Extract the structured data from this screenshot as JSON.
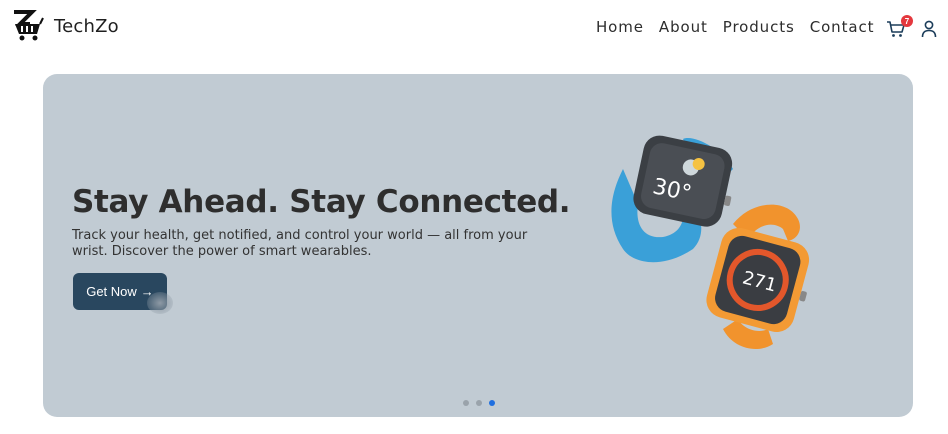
{
  "brand": {
    "name": "TechZo",
    "logo_icon": "shopping-cart-z-logo"
  },
  "nav": {
    "items": [
      {
        "label": "Home"
      },
      {
        "label": "About"
      },
      {
        "label": "Products"
      },
      {
        "label": "Contact"
      }
    ]
  },
  "header_icons": {
    "cart_icon": "cart-icon",
    "cart_count": "7",
    "user_icon": "user-icon"
  },
  "hero": {
    "headline": "Stay Ahead. Stay Connected.",
    "subtext": "Track your health, get notified, and control your world — all from your wrist. Discover the power of smart wearables.",
    "cta_label": "Get Now",
    "cta_arrow": "→",
    "background": "#c1cbd3",
    "cta_color": "#29475f",
    "watch_blue_display": "30°",
    "watch_orange_display": "271"
  },
  "carousel": {
    "slides": 3,
    "active_index": 2,
    "active_color": "#1f6fe0"
  },
  "colors": {
    "badge": "#e4383e"
  }
}
